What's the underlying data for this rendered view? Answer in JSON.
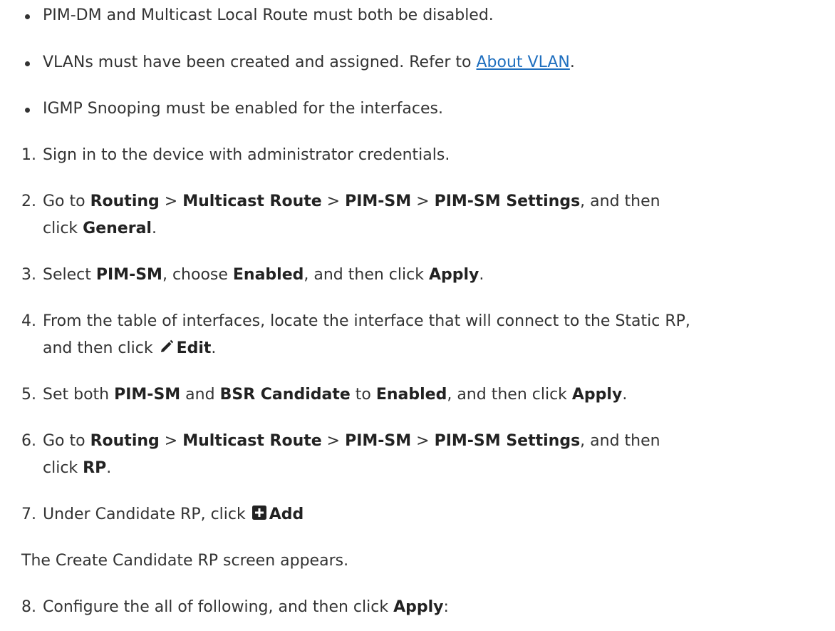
{
  "bullets": [
    {
      "text": "PIM-DM and Multicast Local Route must both be disabled."
    },
    {
      "text_before": "VLANs must have been created and assigned. Refer to ",
      "link": "About VLAN",
      "text_after": "."
    },
    {
      "text": "IGMP Snooping must be enabled for the interfaces."
    }
  ],
  "steps": {
    "s1": {
      "num": "1.",
      "text": "Sign in to the device with administrator credentials."
    },
    "s2": {
      "num": "2.",
      "t1": "Go to ",
      "b1": "Routing",
      "t2": " > ",
      "b2": "Multicast Route",
      "t3": " > ",
      "b3": "PIM-SM",
      "t4": " > ",
      "b4": "PIM-SM Settings",
      "t5": ", and then",
      "t6": "click ",
      "b5": "General",
      "t7": "."
    },
    "s3": {
      "num": "3.",
      "t1": "Select ",
      "b1": "PIM-SM",
      "t2": ", choose ",
      "b2": "Enabled",
      "t3": ", and then click ",
      "b3": "Apply",
      "t4": "."
    },
    "s4": {
      "num": "4.",
      "t1": "From the table of interfaces, locate the interface that will connect to the Static RP,",
      "t2": "and then click ",
      "b1": "Edit",
      "t3": "."
    },
    "s5": {
      "num": "5.",
      "t1": "Set both ",
      "b1": "PIM-SM",
      "t2": " and ",
      "b2": "BSR Candidate",
      "t3": " to ",
      "b3": "Enabled",
      "t4": ", and then click ",
      "b4": "Apply",
      "t5": "."
    },
    "s6": {
      "num": "6.",
      "t1": "Go to ",
      "b1": "Routing",
      "t2": " > ",
      "b2": "Multicast Route",
      "t3": " > ",
      "b3": "PIM-SM",
      "t4": " > ",
      "b4": "PIM-SM Settings",
      "t5": ", and then",
      "t6": "click ",
      "b5": "RP",
      "t7": "."
    },
    "s7": {
      "num": "7.",
      "t1": "Under Candidate RP, click ",
      "b1": "Add"
    },
    "note": "The Create Candidate RP screen appears.",
    "s8": {
      "num": "8.",
      "t1": "Configure the all of following, and then click ",
      "b1": "Apply",
      "t2": ":"
    }
  },
  "icons": {
    "edit": "pencil-icon",
    "add": "plus-square-icon"
  },
  "colors": {
    "text": "#333333",
    "link": "#1f6fbf"
  }
}
